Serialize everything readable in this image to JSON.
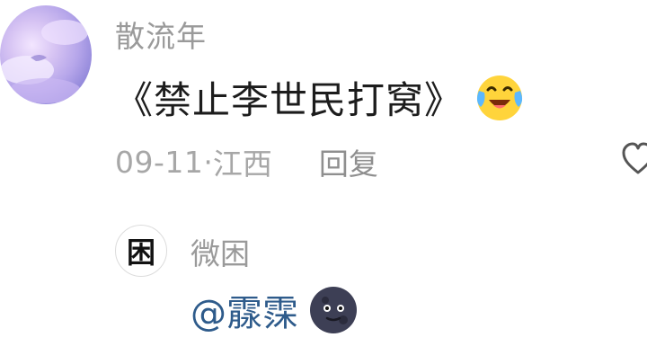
{
  "comment": {
    "username": "散流年",
    "text": "《禁止李世民打窝》",
    "emoji_icon": "crying-laughing-emoji-icon",
    "date": "09-11",
    "separator": " · ",
    "location": "江西",
    "reply_label": "回复",
    "like_icon": "heart-outline-icon"
  },
  "reply": {
    "avatar_char": "困",
    "username": "微困",
    "mention": "@霡霂",
    "emoji_icon": "moon-face-emoji-icon"
  },
  "colors": {
    "username_gray": "#9a9a9a",
    "meta_gray": "#a7a7a7",
    "mention_blue": "#2e5b8b",
    "text_dark": "#1c1c1c"
  }
}
